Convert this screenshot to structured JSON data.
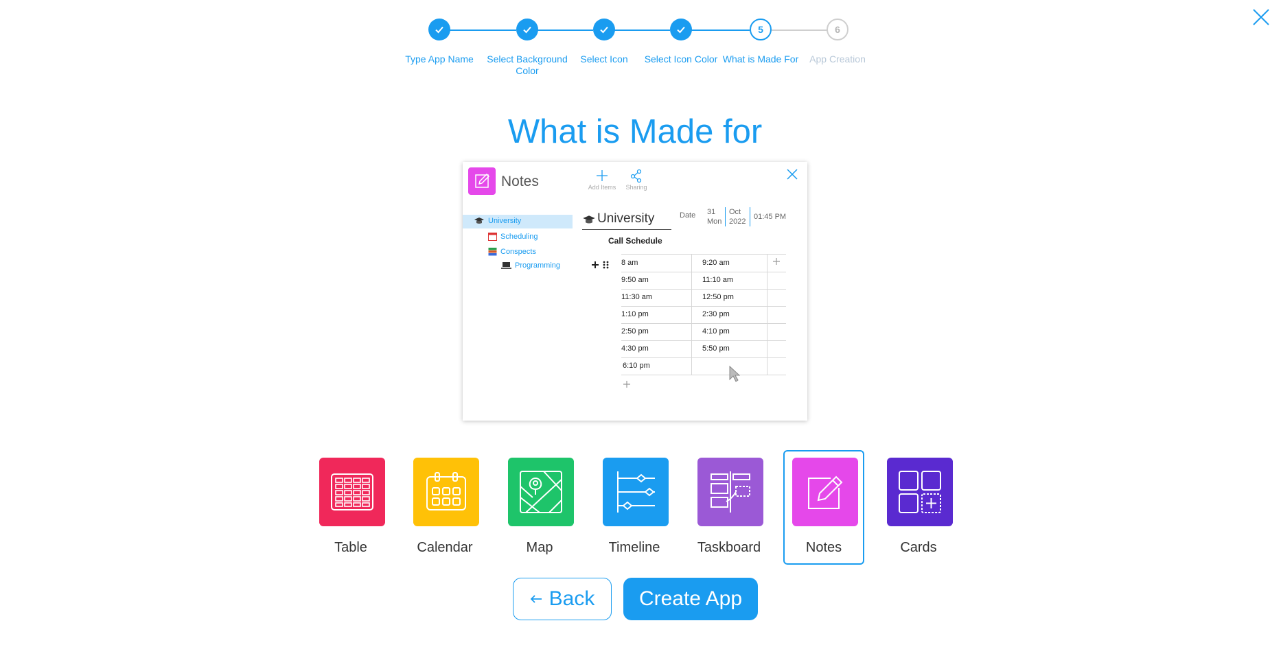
{
  "close_icon": "close-icon",
  "stepper": {
    "steps": [
      {
        "number": "1",
        "label": "Type App Name",
        "state": "done"
      },
      {
        "number": "2",
        "label": "Select Background Color",
        "state": "done"
      },
      {
        "number": "3",
        "label": "Select Icon",
        "state": "done"
      },
      {
        "number": "4",
        "label": "Select Icon Color",
        "state": "done"
      },
      {
        "number": "5",
        "label": "What is Made For",
        "state": "active"
      },
      {
        "number": "6",
        "label": "App Creation",
        "state": "todo"
      }
    ]
  },
  "title": "What is Made for",
  "preview": {
    "app_title": "Notes",
    "tools": {
      "add": "Add Items",
      "sharing": "Sharing"
    },
    "tree": {
      "root": "University",
      "items": [
        "Scheduling",
        "Conspects",
        "Programming"
      ]
    },
    "note_title": "University",
    "date": {
      "label": "Date",
      "day": "31",
      "weekday": "Mon",
      "month": "Oct",
      "year": "2022",
      "time": "01:45 PM"
    },
    "subtitle": "Call Schedule",
    "rows": [
      [
        "8 am",
        "9:20 am"
      ],
      [
        "9:50 am",
        "11:10 am"
      ],
      [
        "11:30 am",
        "12:50 pm"
      ],
      [
        "1:10 pm",
        "2:30 pm"
      ],
      [
        "2:50 pm",
        "4:10 pm"
      ],
      [
        "4:30 pm",
        "5:50 pm"
      ],
      [
        "6:10 pm",
        ""
      ]
    ]
  },
  "app_types": [
    {
      "label": "Table",
      "color": "#f0285a",
      "icon": "table-icon"
    },
    {
      "label": "Calendar",
      "color": "#ffc107",
      "icon": "calendar-icon"
    },
    {
      "label": "Map",
      "color": "#1ec46a",
      "icon": "map-icon"
    },
    {
      "label": "Timeline",
      "color": "#1a9cf0",
      "icon": "timeline-icon"
    },
    {
      "label": "Taskboard",
      "color": "#9b59d6",
      "icon": "taskboard-icon"
    },
    {
      "label": "Notes",
      "color": "#e548ea",
      "icon": "notes-icon",
      "selected": true
    },
    {
      "label": "Cards",
      "color": "#5a2ad0",
      "icon": "cards-icon"
    }
  ],
  "buttons": {
    "back": "Back",
    "create": "Create App"
  },
  "accent_color": "#1a9cf0"
}
